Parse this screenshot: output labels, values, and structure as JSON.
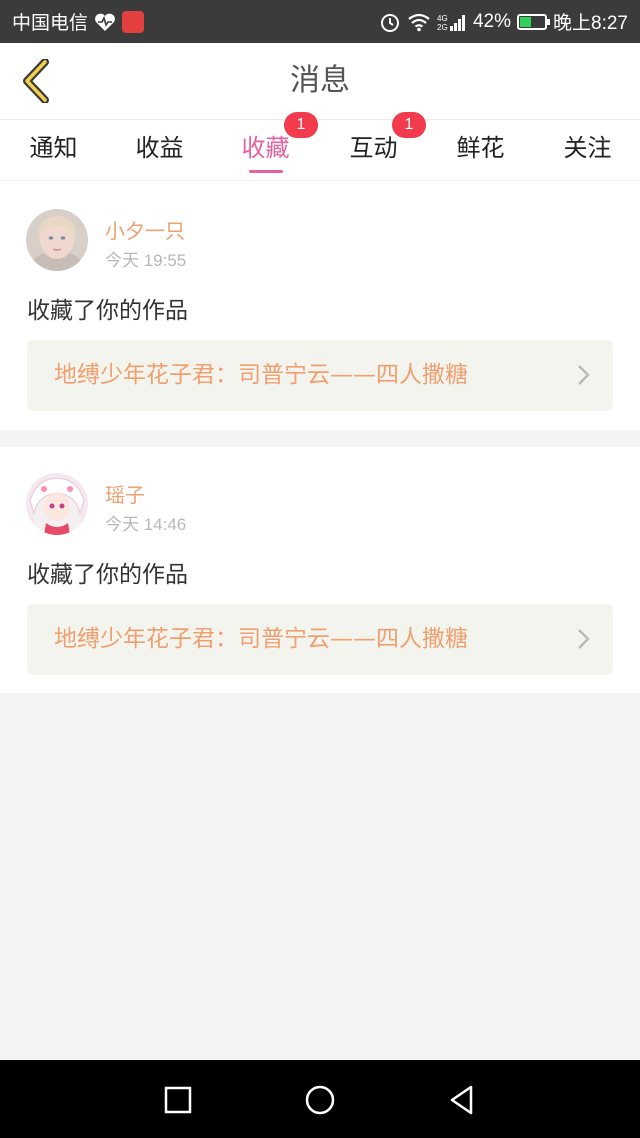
{
  "status_bar": {
    "carrier": "中国电信",
    "battery_percent": "42%",
    "battery_level": 0.42,
    "time": "晚上8:27"
  },
  "header": {
    "title": "消息"
  },
  "tabs": [
    {
      "label": "通知",
      "badge": "",
      "active": false
    },
    {
      "label": "收益",
      "badge": "",
      "active": false
    },
    {
      "label": "收藏",
      "badge": "1",
      "active": true
    },
    {
      "label": "互动",
      "badge": "1",
      "active": false
    },
    {
      "label": "鲜花",
      "badge": "",
      "active": false
    },
    {
      "label": "关注",
      "badge": "",
      "active": false
    }
  ],
  "notifications": [
    {
      "username": "小夕一只",
      "time": "今天 19:55",
      "action": "收藏了你的作品",
      "work_title": "地缚少年花子君：司普宁云——四人撒糖"
    },
    {
      "username": "瑶子",
      "time": "今天 14:46",
      "action": "收藏了你的作品",
      "work_title": "地缚少年花子君：司普宁云——四人撒糖"
    }
  ],
  "colors": {
    "accent": "#e8609e",
    "username": "#f0a070",
    "badge": "#f23b4c"
  }
}
